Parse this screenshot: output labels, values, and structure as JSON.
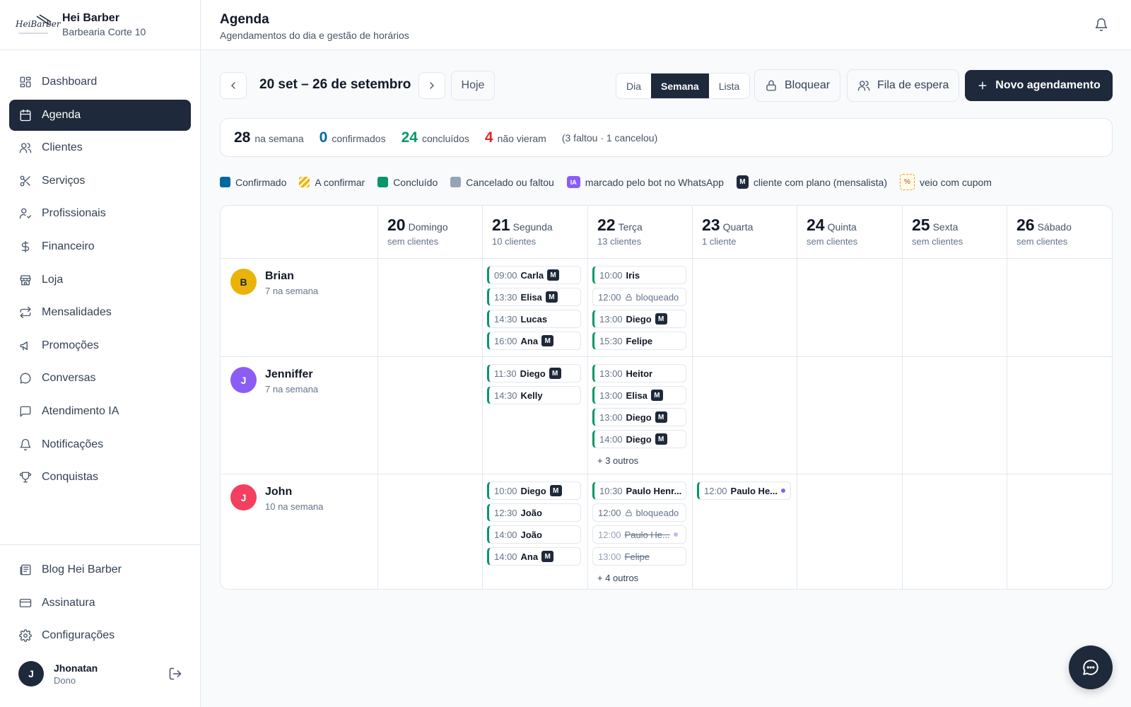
{
  "brand": {
    "logo_text": "HeiBarber",
    "name": "Hei Barber",
    "subtitle": "Barbearia Corte 10"
  },
  "nav": [
    {
      "label": "Dashboard",
      "icon": "dashboard-icon"
    },
    {
      "label": "Agenda",
      "icon": "calendar-icon",
      "active": true
    },
    {
      "label": "Clientes",
      "icon": "users-icon"
    },
    {
      "label": "Serviços",
      "icon": "scissors-icon"
    },
    {
      "label": "Profissionais",
      "icon": "user-check-icon"
    },
    {
      "label": "Financeiro",
      "icon": "dollar-icon"
    },
    {
      "label": "Loja",
      "icon": "store-icon"
    },
    {
      "label": "Mensalidades",
      "icon": "repeat-icon"
    },
    {
      "label": "Promoções",
      "icon": "megaphone-icon"
    },
    {
      "label": "Conversas",
      "icon": "chat-icon"
    },
    {
      "label": "Atendimento IA",
      "icon": "message-square-icon"
    },
    {
      "label": "Notificações",
      "icon": "bell-icon"
    },
    {
      "label": "Conquistas",
      "icon": "trophy-icon"
    }
  ],
  "nav_bottom": [
    {
      "label": "Blog Hei Barber",
      "icon": "newspaper-icon"
    },
    {
      "label": "Assinatura",
      "icon": "credit-card-icon"
    },
    {
      "label": "Configurações",
      "icon": "gear-icon"
    }
  ],
  "user": {
    "initial": "J",
    "name": "Jhonatan",
    "role": "Dono"
  },
  "header": {
    "title": "Agenda",
    "subtitle": "Agendamentos do dia e gestão de horários"
  },
  "toolbar": {
    "range": "20 set – 26 de setembro",
    "today": "Hoje",
    "views": [
      "Dia",
      "Semana",
      "Lista"
    ],
    "active_view": "Semana",
    "block": "Bloquear",
    "waitlist": "Fila de espera",
    "new": "Novo agendamento"
  },
  "stats": {
    "week": {
      "value": "28",
      "label": "na semana"
    },
    "confirmed": {
      "value": "0",
      "label": "confirmados"
    },
    "done": {
      "value": "24",
      "label": "concluídos"
    },
    "noshow": {
      "value": "4",
      "label": "não vieram"
    },
    "detail": "(3 faltou · 1 cancelou)"
  },
  "legend": {
    "confirmed": "Confirmado",
    "pending": "A confirmar",
    "done": "Concluído",
    "cancelled": "Cancelado ou faltou",
    "ia_tag": "IA",
    "ia": "marcado pelo bot no WhatsApp",
    "m_tag": "M",
    "member": "cliente com plano (mensalista)",
    "coupon_tag": "%",
    "coupon": "veio com cupom"
  },
  "days": [
    {
      "num": "20",
      "name": "Domingo",
      "count": "sem clientes"
    },
    {
      "num": "21",
      "name": "Segunda",
      "count": "10 clientes"
    },
    {
      "num": "22",
      "name": "Terça",
      "count": "13 clientes"
    },
    {
      "num": "23",
      "name": "Quarta",
      "count": "1 cliente"
    },
    {
      "num": "24",
      "name": "Quinta",
      "count": "sem clientes"
    },
    {
      "num": "25",
      "name": "Sexta",
      "count": "sem clientes"
    },
    {
      "num": "26",
      "name": "Sábado",
      "count": "sem clientes"
    }
  ],
  "barbers": [
    {
      "initial": "B",
      "name": "Brian",
      "count": "7 na semana",
      "color": "#eab308",
      "text_color": "#1e293b"
    },
    {
      "initial": "J",
      "name": "Jenniffer",
      "count": "7 na semana",
      "color": "#8b5cf6",
      "text_color": "#ffffff"
    },
    {
      "initial": "J",
      "name": "John",
      "count": "10 na semana",
      "color": "#f43f5e",
      "text_color": "#ffffff"
    }
  ],
  "appointments": [
    {
      "row": 0,
      "day": 1,
      "slot": 0,
      "time": "09:00",
      "client": "Carla",
      "m": true,
      "status": "done"
    },
    {
      "row": 0,
      "day": 1,
      "slot": 1,
      "time": "13:30",
      "client": "Elisa",
      "m": true,
      "status": "done"
    },
    {
      "row": 0,
      "day": 1,
      "slot": 2,
      "time": "14:30",
      "client": "Lucas",
      "status": "done"
    },
    {
      "row": 0,
      "day": 1,
      "slot": 3,
      "time": "16:00",
      "client": "Ana",
      "m": true,
      "status": "done"
    },
    {
      "row": 0,
      "day": 2,
      "slot": 0,
      "time": "10:00",
      "client": "Iris",
      "status": "done"
    },
    {
      "row": 0,
      "day": 2,
      "slot": 1,
      "time": "12:00",
      "client": "bloqueado",
      "status": "blocked"
    },
    {
      "row": 0,
      "day": 2,
      "slot": 2,
      "time": "13:00",
      "client": "Diego",
      "m": true,
      "status": "done"
    },
    {
      "row": 0,
      "day": 2,
      "slot": 3,
      "time": "15:30",
      "client": "Felipe",
      "status": "done"
    },
    {
      "row": 1,
      "day": 1,
      "slot": 0,
      "time": "11:30",
      "client": "Diego",
      "m": true,
      "status": "done"
    },
    {
      "row": 1,
      "day": 1,
      "slot": 1,
      "time": "14:30",
      "client": "Kelly",
      "status": "done"
    },
    {
      "row": 1,
      "day": 2,
      "slot": 0,
      "time": "13:00",
      "client": "Heitor",
      "status": "done"
    },
    {
      "row": 1,
      "day": 2,
      "slot": 1,
      "time": "13:00",
      "client": "Elisa",
      "m": true,
      "status": "done"
    },
    {
      "row": 1,
      "day": 2,
      "slot": 2,
      "time": "13:00",
      "client": "Diego",
      "m": true,
      "status": "done"
    },
    {
      "row": 1,
      "day": 2,
      "slot": 3,
      "time": "14:00",
      "client": "Diego",
      "m": true,
      "status": "done"
    },
    {
      "row": 2,
      "day": 1,
      "slot": 0,
      "time": "10:00",
      "client": "Diego",
      "m": true,
      "status": "done"
    },
    {
      "row": 2,
      "day": 1,
      "slot": 1,
      "time": "12:30",
      "client": "João",
      "status": "done"
    },
    {
      "row": 2,
      "day": 1,
      "slot": 2,
      "time": "14:00",
      "client": "João",
      "status": "done"
    },
    {
      "row": 2,
      "day": 1,
      "slot": 3,
      "time": "14:00",
      "client": "Ana",
      "m": true,
      "status": "done"
    },
    {
      "row": 2,
      "day": 2,
      "slot": 0,
      "time": "10:30",
      "client": "Paulo Henr...",
      "status": "done"
    },
    {
      "row": 2,
      "day": 2,
      "slot": 1,
      "time": "12:00",
      "client": "bloqueado",
      "status": "blocked"
    },
    {
      "row": 2,
      "day": 2,
      "slot": 2,
      "time": "12:00",
      "client": "Paulo He...",
      "status": "cancelled",
      "ia": true
    },
    {
      "row": 2,
      "day": 2,
      "slot": 3,
      "time": "13:00",
      "client": "Felipe",
      "status": "cancelled"
    },
    {
      "row": 2,
      "day": 3,
      "slot": 0,
      "time": "12:00",
      "client": "Paulo He...",
      "status": "done",
      "ia": true
    }
  ],
  "more": [
    {
      "row": 1,
      "day": 2,
      "label": "+ 3 outros"
    },
    {
      "row": 2,
      "day": 2,
      "label": "+ 4 outros"
    }
  ]
}
